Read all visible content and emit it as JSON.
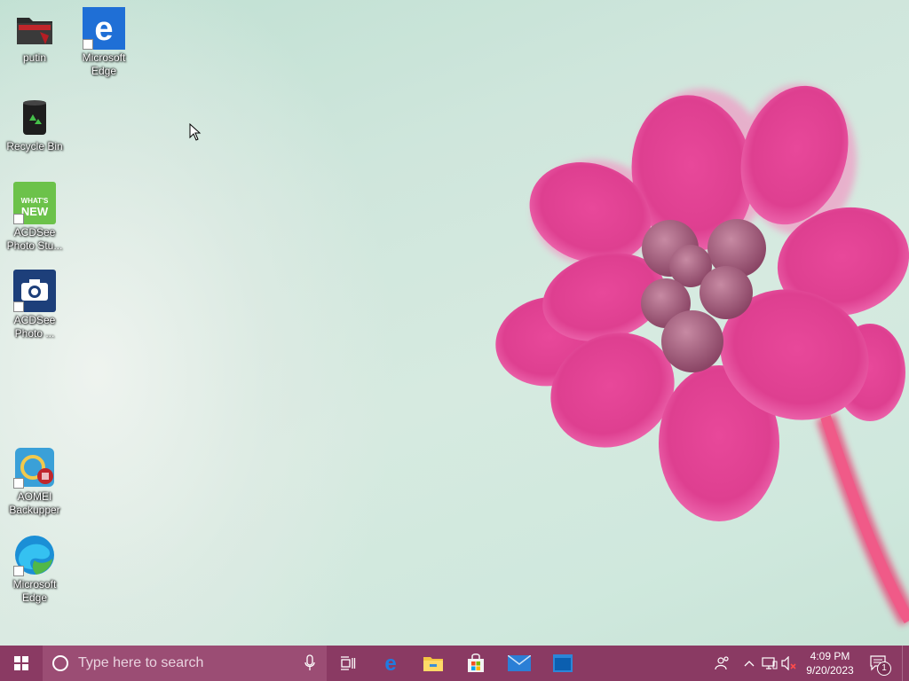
{
  "desktop": {
    "icons": [
      {
        "name": "putin-folder",
        "label": "putin"
      },
      {
        "name": "microsoft-edge-legacy",
        "label": "Microsoft Edge"
      },
      {
        "name": "recycle-bin",
        "label": "Recycle Bin"
      },
      {
        "name": "acdsee-photo-studio",
        "label": "ACDSee Photo Stu..."
      },
      {
        "name": "acdsee-photo",
        "label": "ACDSee Photo ..."
      },
      {
        "name": "aomei-backupper",
        "label": "AOMEI Backupper"
      },
      {
        "name": "microsoft-edge",
        "label": "Microsoft Edge"
      }
    ],
    "acdsee_badge_line1": "WHAT'S",
    "acdsee_badge_line2": "NEW"
  },
  "taskbar": {
    "search_placeholder": "Type here to search",
    "pinned": [
      "microsoft-edge-legacy-icon",
      "file-explorer-icon",
      "microsoft-store-icon",
      "mail-icon",
      "window-app-icon"
    ],
    "clock_time": "4:09 PM",
    "clock_date": "9/20/2023",
    "notification_count": "1",
    "colors": {
      "taskbar": "#8a3a63",
      "search": "#9b4d74",
      "accent": "#0078d7"
    }
  }
}
